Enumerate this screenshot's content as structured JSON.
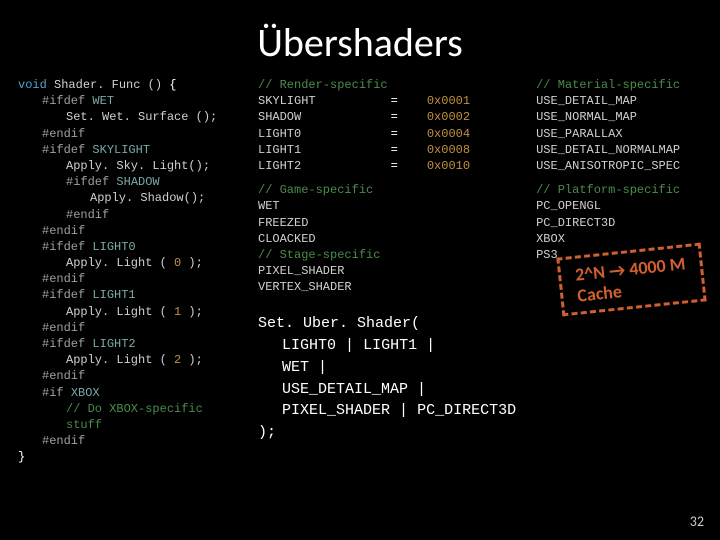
{
  "title": "Übershaders",
  "code": {
    "fn_sig": {
      "kw": "void",
      "name": "Shader. Func ()",
      "open": "{"
    },
    "l_ifdef_wet": {
      "pp": "#ifdef",
      "mac": "WET"
    },
    "l_setwet": "Set. Wet. Surface ();",
    "l_endif1": "#endif",
    "l_ifdef_sky": {
      "pp": "#ifdef",
      "mac": "SKYLIGHT"
    },
    "l_applysky": "Apply. Sky. Light();",
    "l_ifdef_shadow": {
      "pp": "#ifdef",
      "mac": "SHADOW"
    },
    "l_applyshadow": "Apply. Shadow();",
    "l_endif2": "#endif",
    "l_endif3": "#endif",
    "l_ifdef_l0": {
      "pp": "#ifdef",
      "mac": "LIGHT0"
    },
    "l_applyl0": {
      "fn": "Apply. Light (",
      "arg": "0",
      "close": " );"
    },
    "l_endif4": "#endif",
    "l_ifdef_l1": {
      "pp": "#ifdef",
      "mac": "LIGHT1"
    },
    "l_applyl1": {
      "fn": "Apply. Light (",
      "arg": "1",
      "close": " );"
    },
    "l_endif5": "#endif",
    "l_ifdef_l2": {
      "pp": "#ifdef",
      "mac": "LIGHT2"
    },
    "l_applyl2": {
      "fn": "Apply. Light (",
      "arg": "2",
      "close": " );"
    },
    "l_endif6": "#endif",
    "l_if_xbox": {
      "pp": "#if",
      "mac": "XBOX"
    },
    "l_xbox_cmt": "// Do XBOX-specific stuff",
    "l_endif7": "#endif",
    "close": "}"
  },
  "render": {
    "cmt": "// Render-specific",
    "rows": [
      {
        "name": "SKYLIGHT",
        "eq": "=",
        "val": "0x0001"
      },
      {
        "name": "SHADOW",
        "eq": "=",
        "val": "0x0002"
      },
      {
        "name": "LIGHT0",
        "eq": "=",
        "val": "0x0004"
      },
      {
        "name": "LIGHT1",
        "eq": "=",
        "val": "0x0008"
      },
      {
        "name": "LIGHT2",
        "eq": "=",
        "val": "0x0010"
      }
    ]
  },
  "game": {
    "cmt": "// Game-specific",
    "items": [
      "WET",
      "FREEZED",
      "CLOACKED"
    ]
  },
  "stage": {
    "cmt": "// Stage-specific",
    "items": [
      "PIXEL_SHADER",
      "VERTEX_SHADER"
    ]
  },
  "material": {
    "cmt": "// Material-specific",
    "items": [
      "USE_DETAIL_MAP",
      "USE_NORMAL_MAP",
      "USE_PARALLAX",
      "USE_DETAIL_NORMALMAP",
      "USE_ANISOTROPIC_SPEC"
    ]
  },
  "platform": {
    "cmt": "// Platform-specific",
    "items": [
      "PC_OPENGL",
      "PC_DIRECT3D",
      "XBOX",
      "PS3"
    ]
  },
  "call": {
    "fn": "Set. Uber. Shader(",
    "args": [
      "LIGHT0",
      "LIGHT1",
      "WET",
      "USE_DETAIL_MAP",
      "PIXEL_SHADER",
      "PC_DIRECT3D"
    ],
    "sep": "|",
    "close": ");"
  },
  "highlight": {
    "line1": "2^N → 4000 M",
    "line2": "Cache"
  },
  "pagenum": "32"
}
